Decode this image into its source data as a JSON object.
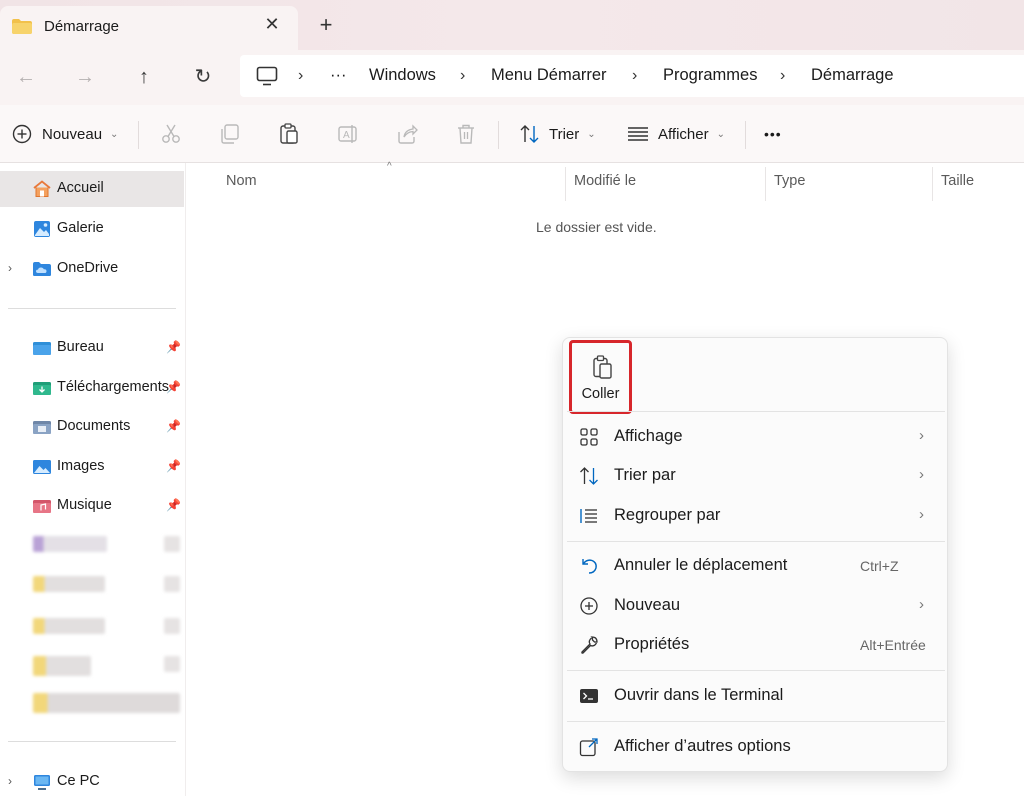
{
  "tab": {
    "title": "Démarrage",
    "close": "✕",
    "new_tab": "+"
  },
  "nav": {
    "back": "←",
    "forward": "→",
    "up": "↑",
    "refresh": "↻"
  },
  "breadcrumb": {
    "more": "···",
    "sep": "›",
    "items": [
      "Windows",
      "Menu Démarrer",
      "Programmes",
      "Démarrage"
    ]
  },
  "commandbar": {
    "new_label": "Nouveau",
    "sort_label": "Trier",
    "view_label": "Afficher",
    "more": "•••",
    "caret": "⌄",
    "icons": [
      "cut-icon",
      "copy-icon",
      "paste-icon",
      "rename-icon",
      "share-icon",
      "delete-icon"
    ]
  },
  "sidebar": {
    "top": [
      {
        "label": "Accueil",
        "icon": "home-icon"
      },
      {
        "label": "Galerie",
        "icon": "gallery-icon"
      },
      {
        "label": "OneDrive",
        "icon": "onedrive-icon"
      }
    ],
    "pinned": [
      {
        "label": "Bureau",
        "icon": "desktop-folder-icon"
      },
      {
        "label": "Téléchargements",
        "icon": "downloads-folder-icon"
      },
      {
        "label": "Documents",
        "icon": "documents-folder-icon"
      },
      {
        "label": "Images",
        "icon": "pictures-folder-icon"
      },
      {
        "label": "Musique",
        "icon": "music-folder-icon"
      }
    ],
    "this_pc": "Ce PC",
    "expander": "›",
    "pin": "📌"
  },
  "columns": {
    "name": "Nom",
    "modified": "Modifié le",
    "type": "Type",
    "size": "Taille",
    "sort_caret": "^"
  },
  "empty_message": "Le dossier est vide.",
  "context_menu": {
    "paste_label": "Coller",
    "items": [
      {
        "label": "Affichage",
        "icon": "view-grid-icon",
        "submenu": "›"
      },
      {
        "label": "Trier par",
        "icon": "sort-icon",
        "submenu": "›"
      },
      {
        "label": "Regrouper par",
        "icon": "group-icon",
        "submenu": "›"
      },
      {
        "label": "Annuler le déplacement",
        "icon": "undo-icon",
        "shortcut": "Ctrl+Z"
      },
      {
        "label": "Nouveau",
        "icon": "new-icon",
        "submenu": "›"
      },
      {
        "label": "Propriétés",
        "icon": "wrench-icon",
        "shortcut": "Alt+Entrée"
      },
      {
        "label": "Ouvrir dans le Terminal",
        "icon": "terminal-icon"
      },
      {
        "label": "Afficher d’autres options",
        "icon": "more-options-icon"
      }
    ]
  },
  "colors": {
    "accent": "#0067c0",
    "highlight_border": "#d7262b",
    "folder": "#f2c14b"
  }
}
